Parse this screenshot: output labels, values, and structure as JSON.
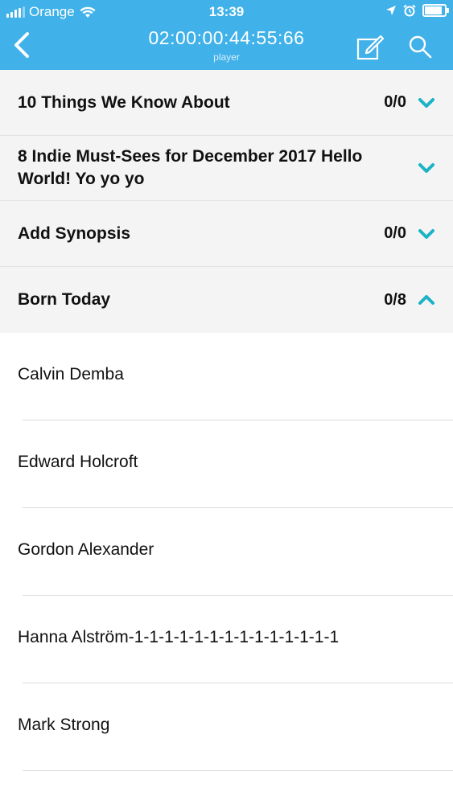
{
  "status_bar": {
    "carrier": "Orange",
    "time": "13:39",
    "battery_level": 0.9
  },
  "nav": {
    "title": "02:00:00:44:55:66",
    "subtitle": "player",
    "back_icon": "chevron-left-icon",
    "edit_icon": "compose-icon",
    "search_icon": "search-icon"
  },
  "colors": {
    "header_bg": "#40b1e9",
    "accent_teal": "#1bb3c5",
    "section_bg": "#f4f4f5"
  },
  "sections": [
    {
      "title": "10 Things We Know About",
      "count": "0/0",
      "expanded": false
    },
    {
      "title": "8 Indie Must-Sees for December 2017 Hello World! Yo yo yo",
      "count": "",
      "expanded": false
    },
    {
      "title": "Add Synopsis",
      "count": "0/0",
      "expanded": false
    },
    {
      "title": "Born Today",
      "count": "0/8",
      "expanded": true
    }
  ],
  "born_today_items": [
    "Calvin Demba",
    "Edward Holcroft",
    "Gordon Alexander",
    "Hanna Alström-1-1-1-1-1-1-1-1-1-1-1-1-1-1",
    "Mark Strong"
  ]
}
